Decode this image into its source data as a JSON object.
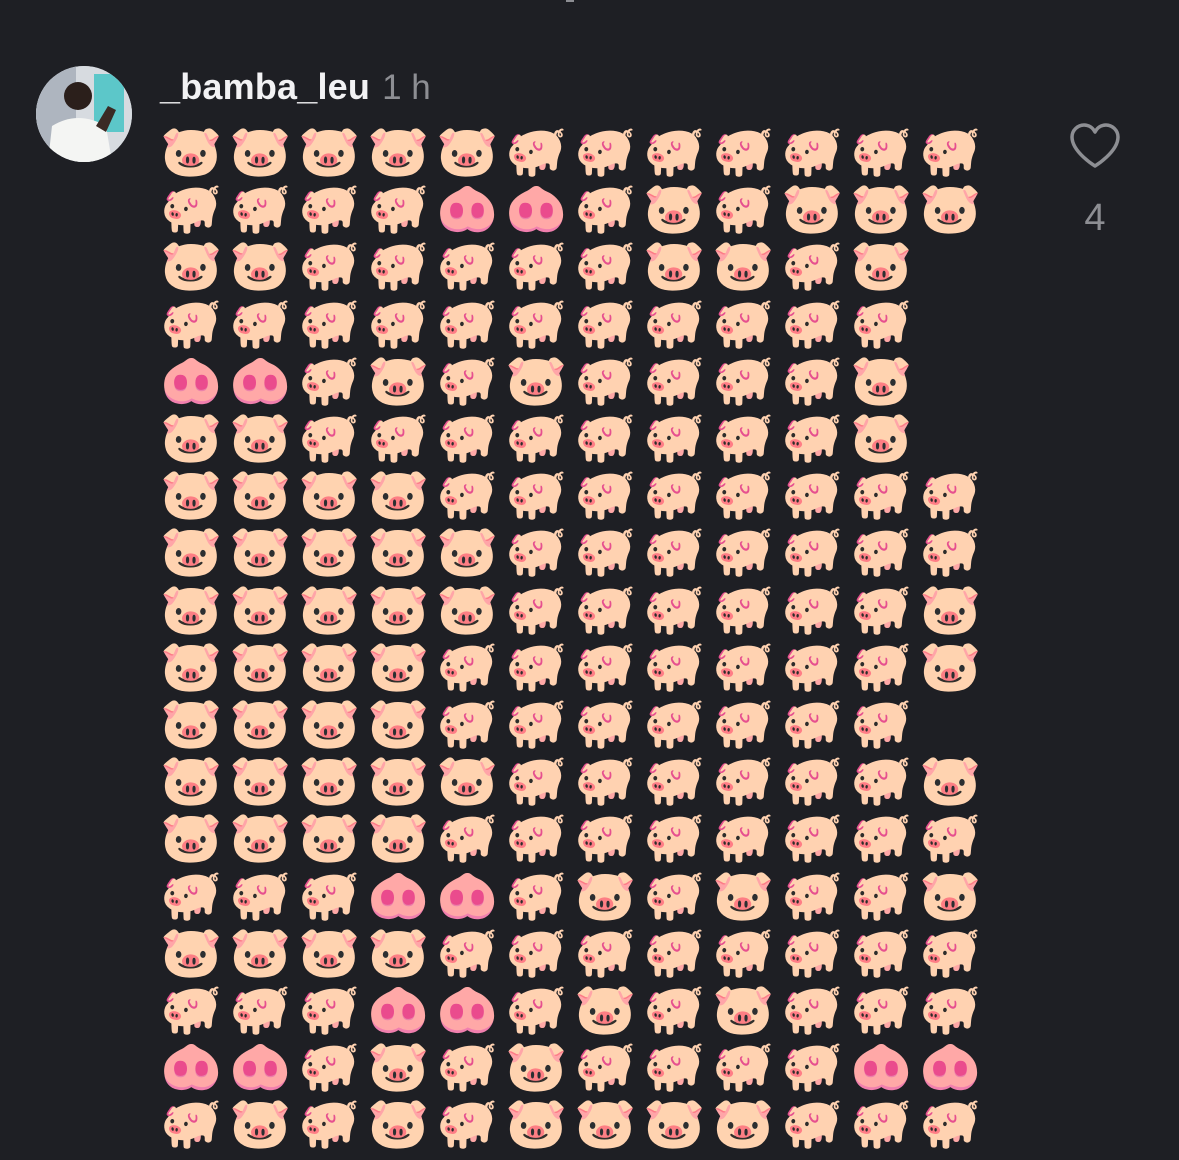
{
  "post": {
    "username": "_bamba_leu",
    "time": "1 h",
    "like_count": "4",
    "rows": [
      "🐷🐷🐷🐷🐷🐖🐖🐖🐖🐖🐖🐖",
      "🐖🐖🐖🐖🐽🐽🐖🐷🐖🐷🐷🐷",
      "🐷🐷🐖🐖🐖🐖🐖🐷🐷🐖🐷",
      "🐖🐖🐖🐖🐖🐖🐖🐖🐖🐖🐖",
      "🐽🐽🐖🐷🐖🐷🐖🐖🐖🐖🐷",
      "🐷🐷🐖🐖🐖🐖🐖🐖🐖🐖🐷",
      "🐷🐷🐷🐷🐖🐖🐖🐖🐖🐖🐖🐖",
      "🐷🐷🐷🐷🐷🐖🐖🐖🐖🐖🐖🐖",
      "🐷🐷🐷🐷🐷🐖🐖🐖🐖🐖🐖🐷",
      "🐷🐷🐷🐷🐖🐖🐖🐖🐖🐖🐖🐷",
      "🐷🐷🐷🐷🐖🐖🐖🐖🐖🐖🐖",
      "🐷🐷🐷🐷🐷🐖🐖🐖🐖🐖🐖🐷",
      "🐷🐷🐷🐷🐖🐖🐖🐖🐖🐖🐖🐖",
      "🐖🐖🐖🐽🐽🐖🐷🐖🐷🐖🐖🐷",
      "🐷🐷🐷🐷🐖🐖🐖🐖🐖🐖🐖🐖",
      "🐖🐖🐖🐽🐽🐖🐷🐖🐷🐖🐖🐖",
      "🐽🐽🐖🐷🐖🐷🐖🐖🐖🐖🐽🐽",
      "🐖🐷🐖🐷🐖🐷🐷🐷🐷🐖🐖🐖"
    ]
  },
  "icons": {
    "like": "heart-outline-icon",
    "avatar": "user-avatar"
  },
  "colors": {
    "background": "#1e1f24",
    "username": "#f2f2f4",
    "muted": "#8d8e93"
  }
}
